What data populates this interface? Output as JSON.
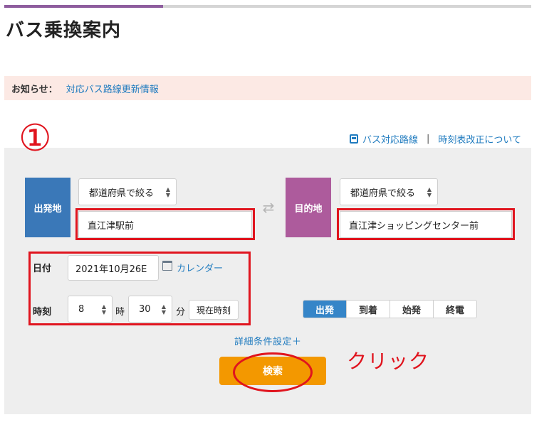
{
  "header": {
    "title": "バス乗換案内"
  },
  "notice": {
    "label": "お知らせ：",
    "link": "対応バス路線更新情報"
  },
  "annotation": {
    "step_number": "①",
    "click_note": "クリック",
    "mark_color": "#e0141e"
  },
  "top_links": {
    "bus_routes": "バス対応路線",
    "timetable_revision": "時刻表改正について",
    "bus_icon": "bus-icon"
  },
  "origin": {
    "label": "出発地",
    "prefecture_filter": "都道府県で絞る",
    "value": "直江津駅前",
    "color": "#3a78b8"
  },
  "destination": {
    "label": "目的地",
    "prefecture_filter": "都道府県で絞る",
    "value": "直江津ショッピングセンター前",
    "color": "#ad5b9c"
  },
  "swap_icon": "swap-arrows-icon",
  "date": {
    "label": "日付",
    "value": "2021年10月26E",
    "calendar_link": "カレンダー",
    "calendar_icon": "calendar-icon"
  },
  "time": {
    "label": "時刻",
    "hour": "8",
    "hour_unit": "時",
    "minute": "30",
    "minute_unit": "分",
    "now_button": "現在時刻"
  },
  "time_type": {
    "options": [
      "出発",
      "到着",
      "始発",
      "終電"
    ],
    "selected": "出発",
    "selected_color": "#3585c8"
  },
  "detail_settings": "詳細条件設定＋",
  "search": {
    "label": "検索",
    "color": "#f39800"
  }
}
